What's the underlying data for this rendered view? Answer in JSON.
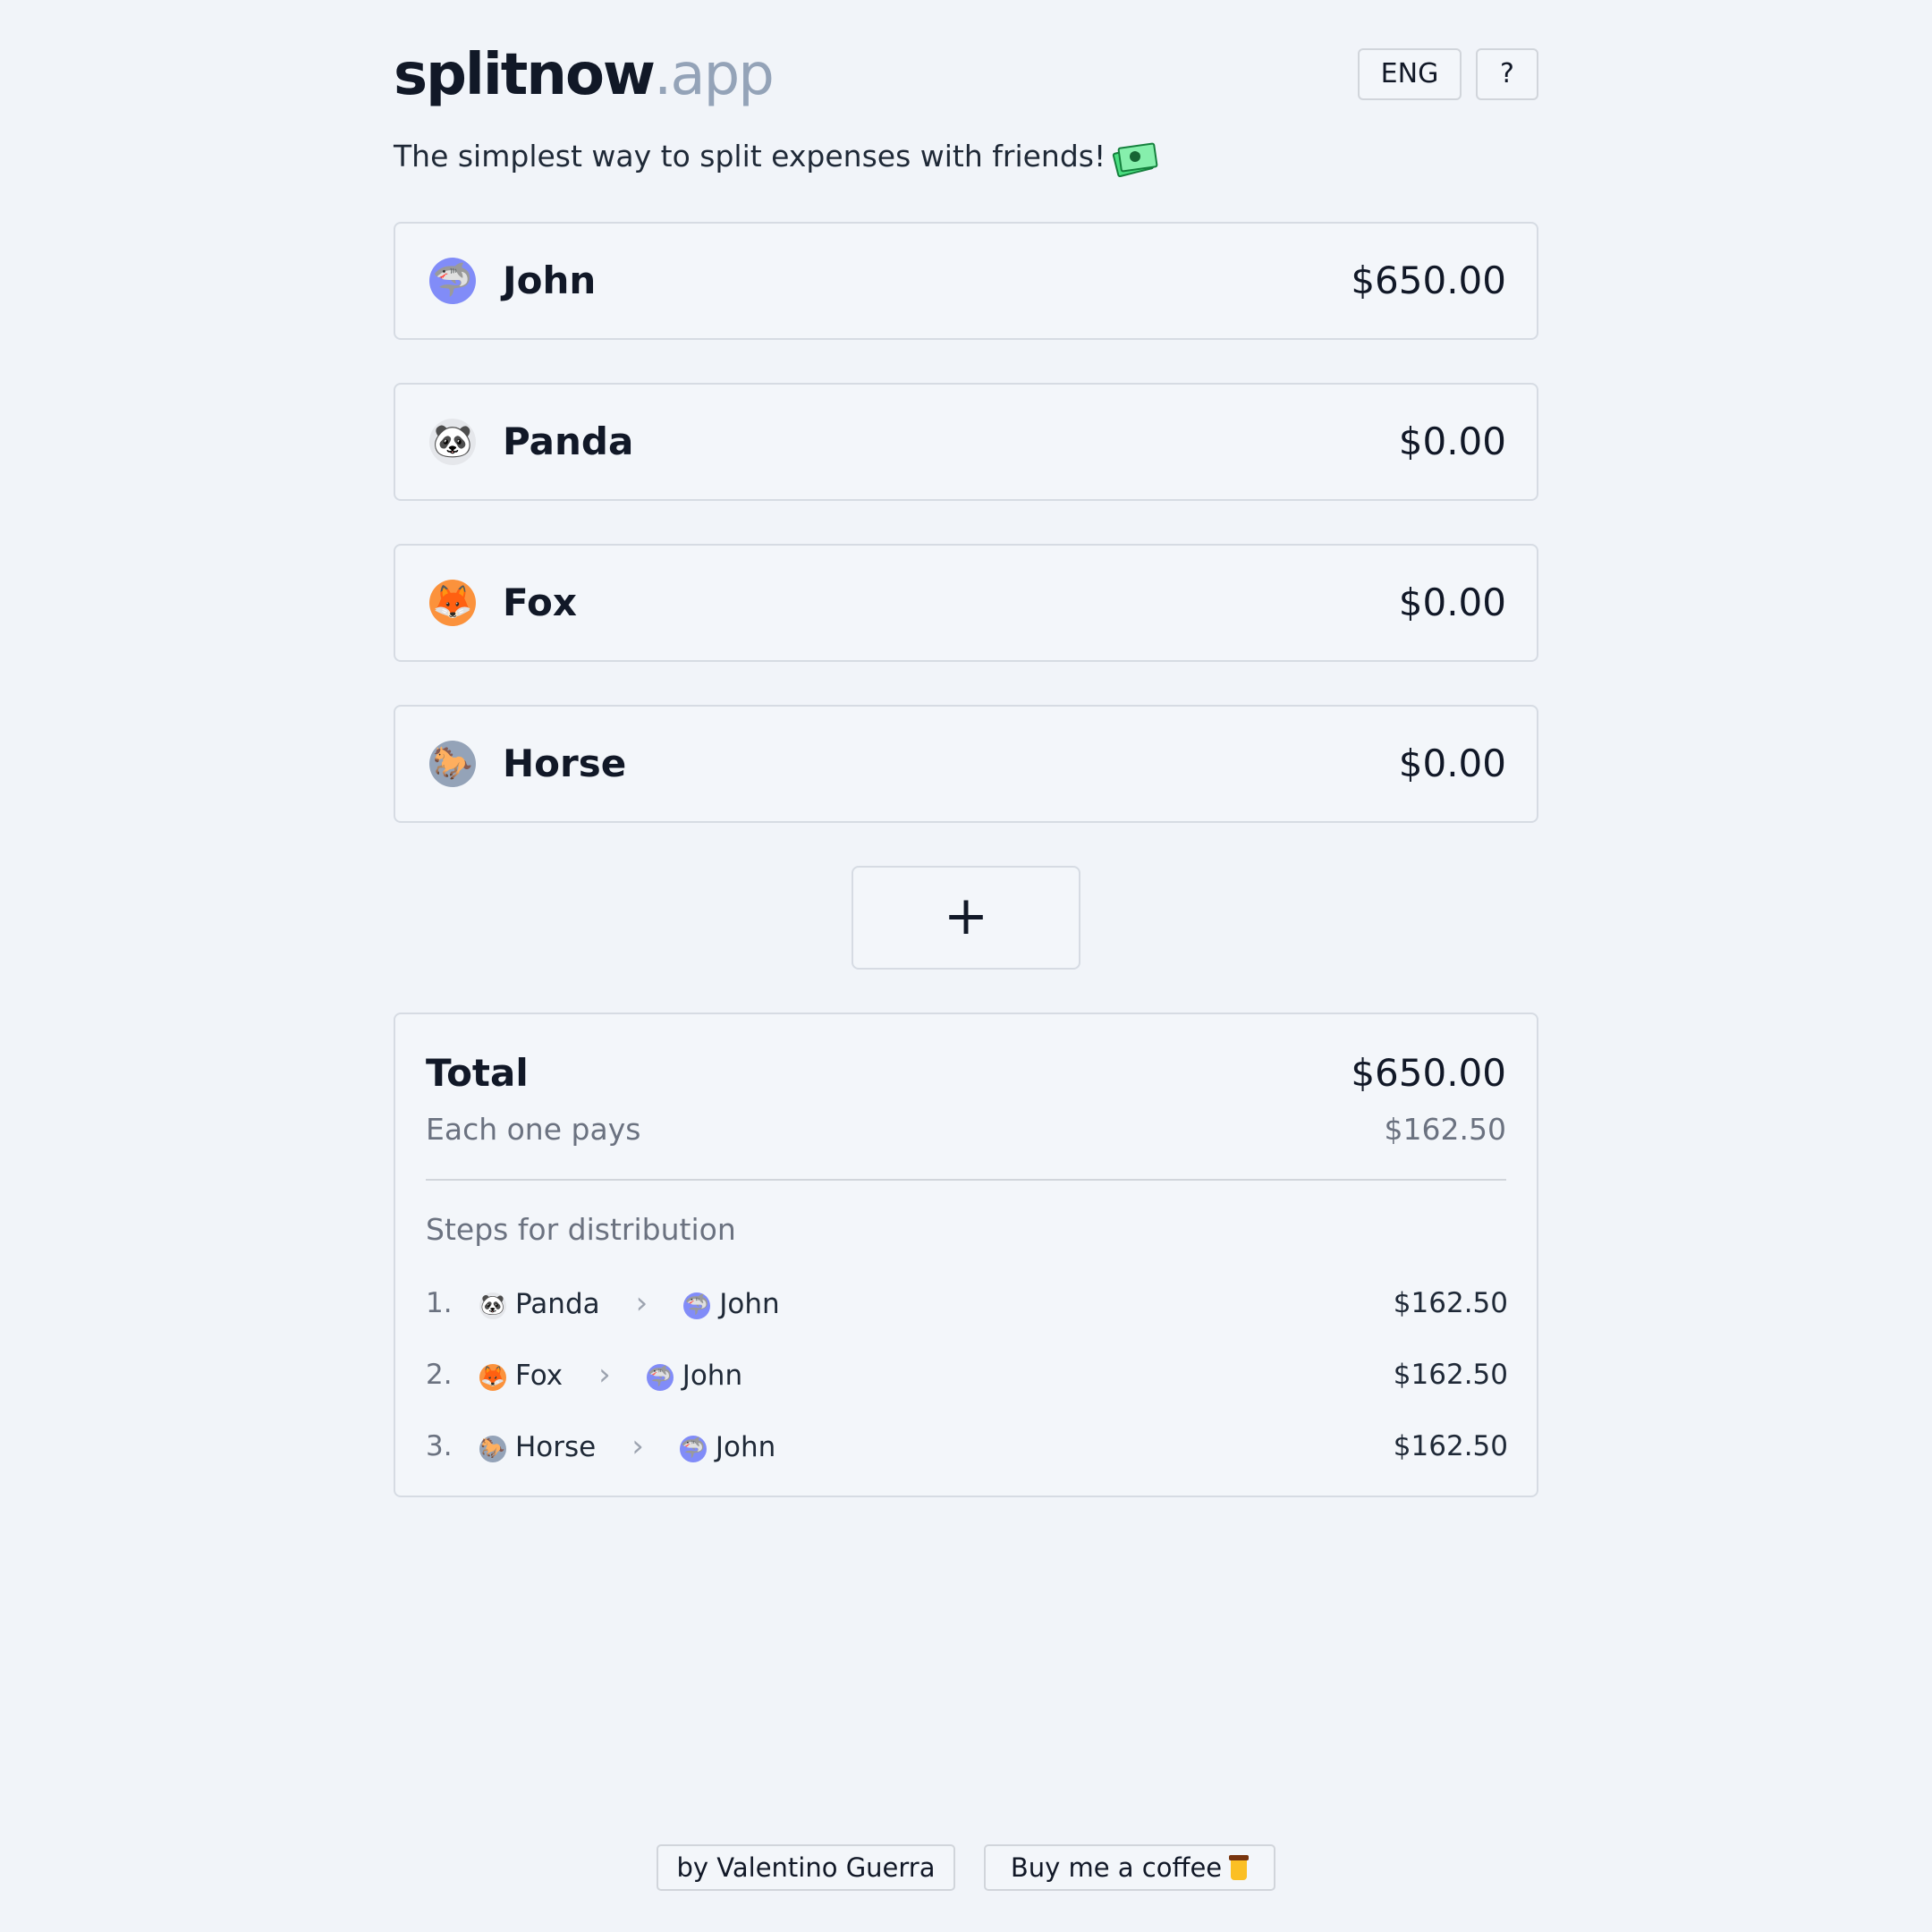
{
  "header": {
    "brand": "splitnow",
    "tld": ".app",
    "language_label": "ENG",
    "help_label": "?"
  },
  "tagline": "The simplest way to split expenses with friends!",
  "tagline_icon": "money-icon",
  "people": [
    {
      "name": "John",
      "amount": "$650.00",
      "icon": "shark",
      "glyph": "🦈",
      "color": "#818cf8"
    },
    {
      "name": "Panda",
      "amount": "$0.00",
      "icon": "panda",
      "glyph": "🐼",
      "color": "#e5e7eb"
    },
    {
      "name": "Fox",
      "amount": "$0.00",
      "icon": "fox",
      "glyph": "🦊",
      "color": "#fb923c"
    },
    {
      "name": "Horse",
      "amount": "$0.00",
      "icon": "horse",
      "glyph": "🐎",
      "color": "#94a3b8"
    }
  ],
  "add_button_label": "+",
  "summary": {
    "total_label": "Total",
    "total_value": "$650.00",
    "each_label": "Each one pays",
    "each_value": "$162.50",
    "steps_title": "Steps for distribution",
    "steps": [
      {
        "num": "1.",
        "from": "Panda",
        "to": "John",
        "amount": "$162.50"
      },
      {
        "num": "2.",
        "from": "Fox",
        "to": "John",
        "amount": "$162.50"
      },
      {
        "num": "3.",
        "from": "Horse",
        "to": "John",
        "amount": "$162.50"
      }
    ]
  },
  "footer": {
    "author_label": "by Valentino Guerra",
    "coffee_label": "Buy me a coffee"
  }
}
